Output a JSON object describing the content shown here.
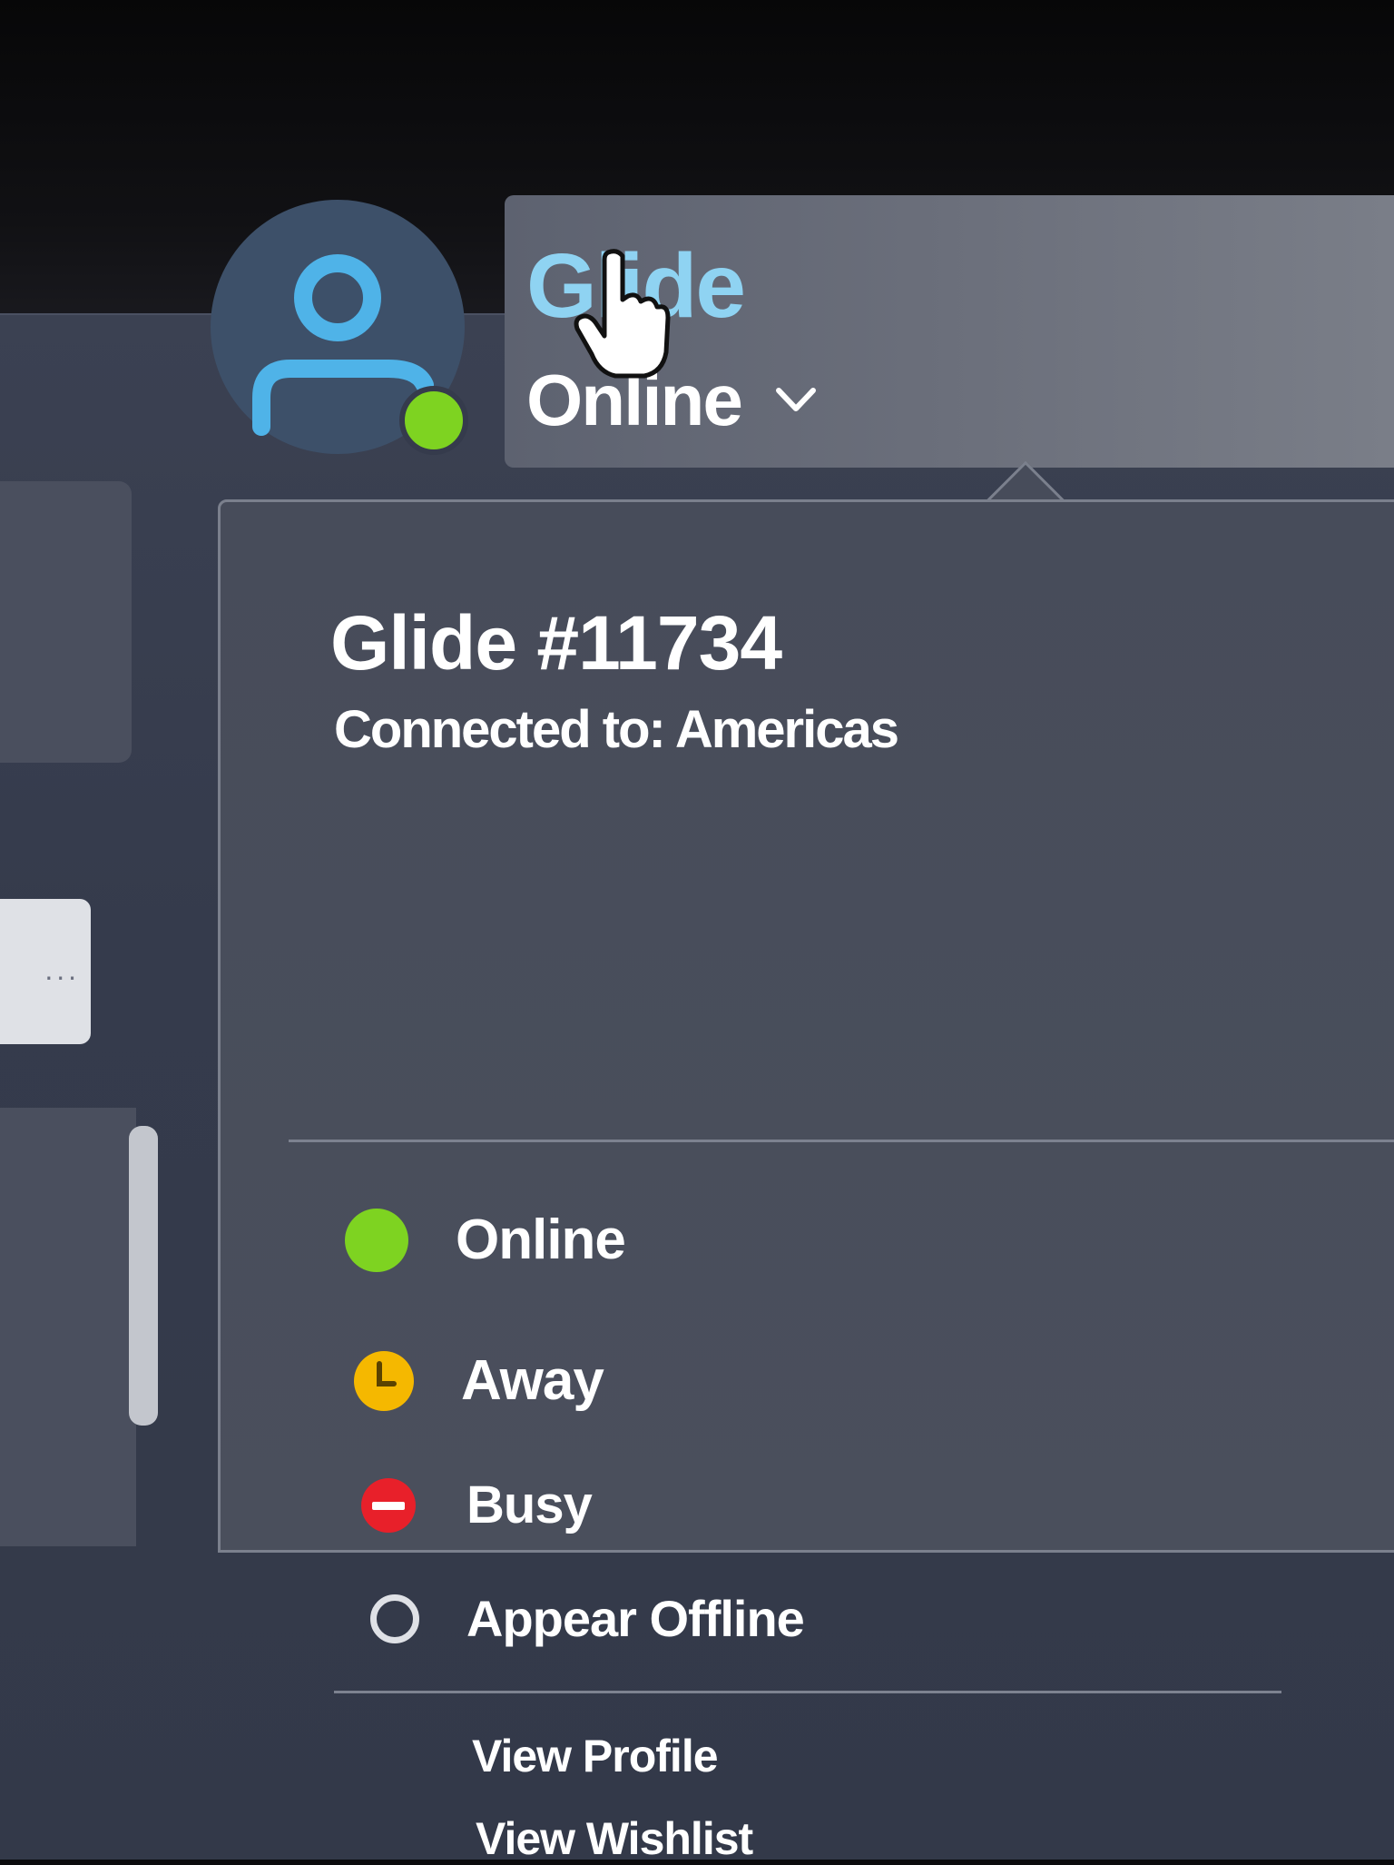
{
  "header": {
    "user_name": "Glide",
    "current_status": "Online"
  },
  "dropdown": {
    "account_title": "Glide #11734",
    "region_text": "Connected to: Americas",
    "status_options": [
      {
        "label": "Online",
        "icon": "online-dot-icon",
        "color": "#7ed321"
      },
      {
        "label": "Away",
        "icon": "away-clock-icon",
        "color": "#f5b800"
      },
      {
        "label": "Busy",
        "icon": "busy-minus-icon",
        "color": "#e8202a"
      },
      {
        "label": "Appear Offline",
        "icon": "offline-ring-icon",
        "color": "#ffffff"
      }
    ],
    "links": [
      "View Profile",
      "View Wishlist"
    ]
  },
  "left_panel": {
    "input_text": "..."
  }
}
